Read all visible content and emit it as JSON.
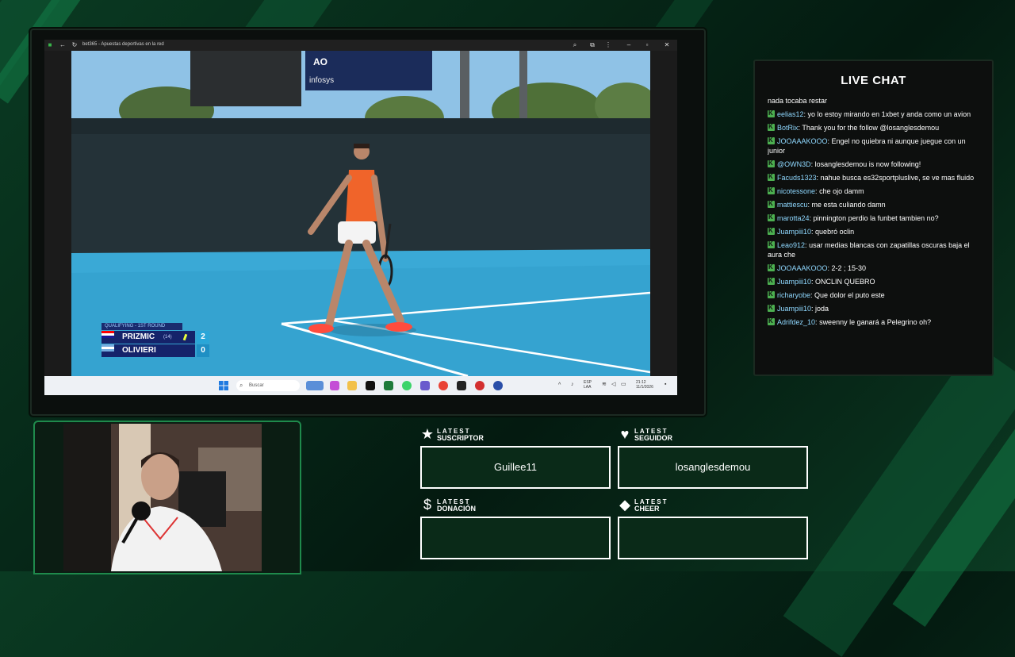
{
  "window": {
    "title": "bet365 - Apuestas deportivas en la red"
  },
  "scoreboard": {
    "round": "QUALIFYING - 1ST ROUND",
    "players": [
      {
        "name": "PRIZMIC",
        "seed": "(14)",
        "score": "2"
      },
      {
        "name": "OLIVIERI",
        "seed": "",
        "score": "0"
      }
    ]
  },
  "taskbar": {
    "search_placeholder": "Buscar",
    "lang": "ESP",
    "lang_sub": "LAA",
    "time": "21:12",
    "date": "11/1/2026"
  },
  "chat": {
    "title": "LIVE CHAT",
    "messages": [
      {
        "user": "",
        "text": "nada tocaba restar",
        "badge": false
      },
      {
        "user": "eelias12",
        "text": "yo lo estoy mirando en 1xbet y anda como un avion",
        "badge": true
      },
      {
        "user": "BotRix",
        "text": "Thank you for the follow @losanglesdemou",
        "badge": true
      },
      {
        "user": "JOOAAAKOOO",
        "text": "Engel no quiebra ni aunque juegue con un junior",
        "badge": true
      },
      {
        "user": "@OWN3D",
        "text": "losanglesdemou is now following!",
        "badge": true
      },
      {
        "user": "Facuds1323",
        "text": "nahue busca es32sportpluslive, se ve mas fluido",
        "badge": true
      },
      {
        "user": "nicotessone",
        "text": "che ojo damm",
        "badge": true
      },
      {
        "user": "mattiescu",
        "text": "me esta culiando damn",
        "badge": true
      },
      {
        "user": "marotta24",
        "text": "pinnington perdio la funbet tambien no?",
        "badge": true
      },
      {
        "user": "Juampiii10",
        "text": "quebró oclin",
        "badge": true
      },
      {
        "user": "Leao912",
        "text": "usar medias blancas con zapatillas oscuras baja el aura che",
        "badge": true
      },
      {
        "user": "JOOAAAKOOO",
        "text": "2-2 ; 15-30",
        "badge": true
      },
      {
        "user": "Juampiii10",
        "text": "ONCLIN QUEBRO",
        "badge": true
      },
      {
        "user": "richaryobe",
        "text": "Que dolor el puto este",
        "badge": true
      },
      {
        "user": "Juampiii10",
        "text": "joda",
        "badge": true
      },
      {
        "user": "Adrifdez_10",
        "text": "sweenny le ganará a Pelegrino oh?",
        "badge": true
      }
    ]
  },
  "widgets": {
    "suscriptor": {
      "small": "LATEST",
      "label": "SUSCRIPTOR",
      "value": "Guillee11",
      "icon": "star-icon"
    },
    "seguidor": {
      "small": "LATEST",
      "label": "SEGUIDOR",
      "value": "losanglesdemou",
      "icon": "heart-icon"
    },
    "donacion": {
      "small": "LATEST",
      "label": "DONACIÓN",
      "value": "",
      "icon": "dollar-icon"
    },
    "cheer": {
      "small": "LATEST",
      "label": "CHEER",
      "value": "",
      "icon": "diamond-icon"
    }
  }
}
